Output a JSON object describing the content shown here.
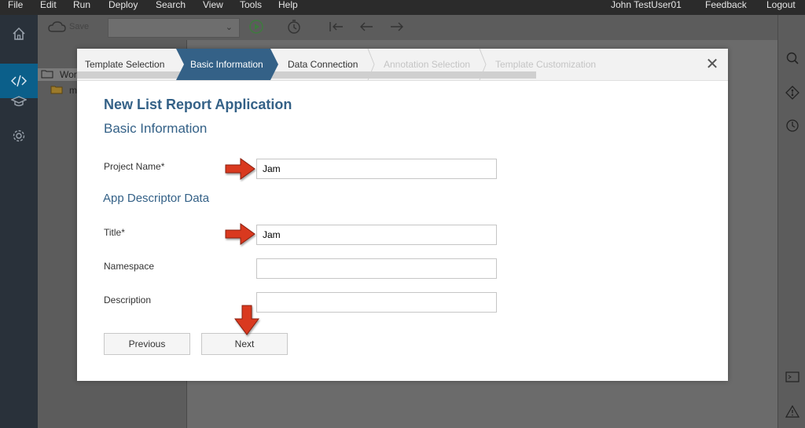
{
  "menu": [
    "File",
    "Edit",
    "Run",
    "Deploy",
    "Search",
    "View",
    "Tools",
    "Help"
  ],
  "user": "John TestUser01",
  "feedback": "Feedback",
  "logout": "Logout",
  "toolbar": {
    "save_label": "Save"
  },
  "tree": {
    "workspace_label": "Wor",
    "item_label": "m"
  },
  "wizard": {
    "steps": [
      {
        "label": "Template Selection",
        "state": "done"
      },
      {
        "label": "Basic Information",
        "state": "active"
      },
      {
        "label": "Data Connection",
        "state": "pending"
      },
      {
        "label": "Annotation Selection",
        "state": "disabled"
      },
      {
        "label": "Template Customization",
        "state": "disabled"
      }
    ],
    "title": "New List Report Application",
    "section_title": "Basic Information",
    "project_name_label": "Project Name*",
    "project_name_value": "Jam",
    "app_descriptor_title": "App Descriptor Data",
    "title_label": "Title*",
    "title_value": "Jam",
    "namespace_label": "Namespace",
    "namespace_value": "",
    "description_label": "Description",
    "description_value": "",
    "previous_label": "Previous",
    "next_label": "Next"
  },
  "colors": {
    "accent": "#346187",
    "active_step": "#346187",
    "arrow": "#d9391f",
    "sidebar_active": "#0b5f8a"
  }
}
